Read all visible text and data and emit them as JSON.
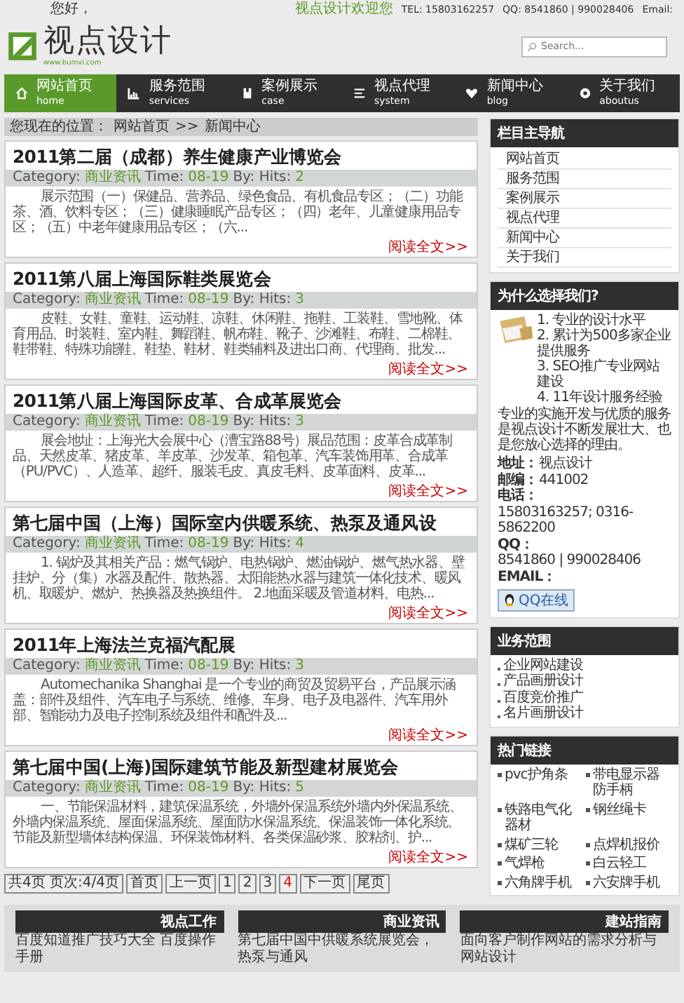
{
  "top_bar": {
    "greeting": "您好，",
    "welcome": "视点设计欢迎您",
    "tel": "TEL: 15803162257",
    "qq": "QQ: 8541860 | 990028406",
    "email": "Email:"
  },
  "logo": {
    "name": "视点设计",
    "url": "www.bumvi.com"
  },
  "search": {
    "placeholder": "Search..."
  },
  "nav": [
    {
      "label": "网站首页",
      "sub": "home",
      "selected": true
    },
    {
      "label": "服务范围",
      "sub": "services",
      "selected": false
    },
    {
      "label": "案例展示",
      "sub": "case",
      "selected": false
    },
    {
      "label": "视点代理",
      "sub": "system",
      "selected": false
    },
    {
      "label": "新闻中心",
      "sub": "blog",
      "selected": false
    },
    {
      "label": "关于我们",
      "sub": "aboutus",
      "selected": false
    }
  ],
  "breadcrumb": {
    "prefix": "您现在的位置：",
    "home": "网站首页",
    "separator": ">>",
    "current": "新闻中心"
  },
  "articles": [
    {
      "title": "2011第二届（成都）养生健康产业博览会",
      "category_label": "Category:",
      "category": "商业资讯",
      "time_label": "Time:",
      "time": "08-19",
      "hits_label": "By: Hits:",
      "hits": "2",
      "excerpt": "展示范围（一）保健品、营养品、绿色食品、有机食品专区；（二）功能茶、酒、饮料专区；（三）健康睡眠产品专区；（四）老年、儿童健康用品专区；（五）中老年健康用品专区；（六...",
      "more": "阅读全文>>"
    },
    {
      "title": "2011第八届上海国际鞋类展览会",
      "category_label": "Category:",
      "category": "商业资讯",
      "time_label": "Time:",
      "time": "08-19",
      "hits_label": "By: Hits:",
      "hits": "3",
      "excerpt": "皮鞋、女鞋、童鞋、运动鞋、凉鞋、休闲鞋、拖鞋、工装鞋、雪地靴、体育用品、时装鞋、室内鞋、舞蹈鞋、帆布鞋、靴子、沙滩鞋、布鞋、二棉鞋、鞋带鞋、特殊功能鞋、鞋垫、鞋材、鞋类辅料及进出口商、代理商、批发...",
      "more": "阅读全文>>"
    },
    {
      "title": "2011第八届上海国际皮革、合成革展览会",
      "category_label": "Category:",
      "category": "商业资讯",
      "time_label": "Time:",
      "time": "08-19",
      "hits_label": "By: Hits:",
      "hits": "3",
      "excerpt": "展会地址：上海光大会展中心（漕宝路88号）展品范围：皮革合成革制品、天然皮革、猪皮革、羊皮革、沙发革、箱包革、汽车装饰用革、合成革（PU/PVC）、人造革、超纤、服装毛皮、真皮毛料、皮革面料、皮革...",
      "more": "阅读全文>>"
    },
    {
      "title": "第七届中国（上海）国际室内供暖系统、热泵及通风设",
      "category_label": "Category:",
      "category": "商业资讯",
      "time_label": "Time:",
      "time": "08-19",
      "hits_label": "By: Hits:",
      "hits": "4",
      "excerpt": "1. 锅炉及其相关产品：燃气锅炉、电热锅炉、燃油锅炉、燃气热水器、壁挂炉、分（集）水器及配件、散热器、太阳能热水器与建筑一体化技术、暖风机、取暖炉、燃炉、热换器及热换组件。 2.地面采暖及管道材料、电热...",
      "more": "阅读全文>>"
    },
    {
      "title": "2011年上海法兰克福汽配展",
      "category_label": "Category:",
      "category": "商业资讯",
      "time_label": "Time:",
      "time": "08-19",
      "hits_label": "By: Hits:",
      "hits": "3",
      "excerpt": "Automechanika Shanghai 是一个专业的商贸及贸易平台，产品展示涵盖：部件及组件、汽车电子与系统、维修、车身、电子及电器件、汽车用外部、智能动力及电子控制系统及组件和配件及...",
      "more": "阅读全文>>"
    },
    {
      "title": "第七届中国(上海)国际建筑节能及新型建材展览会",
      "category_label": "Category:",
      "category": "商业资讯",
      "time_label": "Time:",
      "time": "08-19",
      "hits_label": "By: Hits:",
      "hits": "5",
      "excerpt": "一、节能保温材料，建筑保温系统，外墙外保温系统外墙内外保温系统、外墙内保温系统、屋面保温系统、屋面防水保温系统、保温装饰一体化系统、节能及新型墙体结构保温、环保装饰材料、各类保温砂浆、胶粘剂、护...",
      "more": "阅读全文>>"
    }
  ],
  "pagination": {
    "summary": "共4页 页次:4/4页",
    "first": "首页",
    "prev": "上一页",
    "pages": [
      {
        "label": "1",
        "selected": false
      },
      {
        "label": "2",
        "selected": false
      },
      {
        "label": "3",
        "selected": false
      },
      {
        "label": "4",
        "selected": true
      }
    ],
    "next": "下一页",
    "last": "尾页"
  },
  "sidebar": {
    "nav_title": "栏目主导航",
    "nav_items": [
      "网站首页",
      "服务范围",
      "案例展示",
      "视点代理",
      "新闻中心",
      "关于我们"
    ],
    "why_title": "为什么选择我们?",
    "why_points": [
      "1. 专业的设计水平",
      "2. 累计为500多家企业提供服务",
      "3. SEO推广专业网站建设",
      "4. 11年设计服务经验"
    ],
    "why_text": "专业的实施开发与优质的服务是视点设计不断发展壮大、也是您放心选择的理由。",
    "contacts": [
      {
        "label": "地址：",
        "value": "视点设计"
      },
      {
        "label": "邮编：",
        "value": "441002"
      },
      {
        "label": "电话：",
        "value": "15803163257; 0316-5862200"
      },
      {
        "label": "QQ：",
        "value": "8541860 | 990028406"
      },
      {
        "label": "EMAIL："
      }
    ],
    "qq_button": "QQ在线",
    "business_title": "业务范围",
    "business_items": [
      "企业网站建设",
      "产品画册设计",
      "百度竞价推广",
      "名片画册设计"
    ],
    "links_title": "热门链接",
    "links": [
      "pvc护角条",
      "带电显示器防手柄",
      "铁路电气化器材",
      "钢丝绳卡",
      "煤矿三轮",
      "点焊机报价",
      "气焊枪",
      "白云轻工",
      "六角牌手机",
      "六安牌手机"
    ]
  },
  "footer": [
    {
      "title": "视点工作",
      "text": "百度知道推广技巧大全 百度操作手册"
    },
    {
      "title": "商业资讯",
      "text": "第七届中国中供暖系统展览会，热泵与通风"
    },
    {
      "title": "建站指南",
      "text": "面向客户制作网站的需求分析与网站设计"
    }
  ]
}
